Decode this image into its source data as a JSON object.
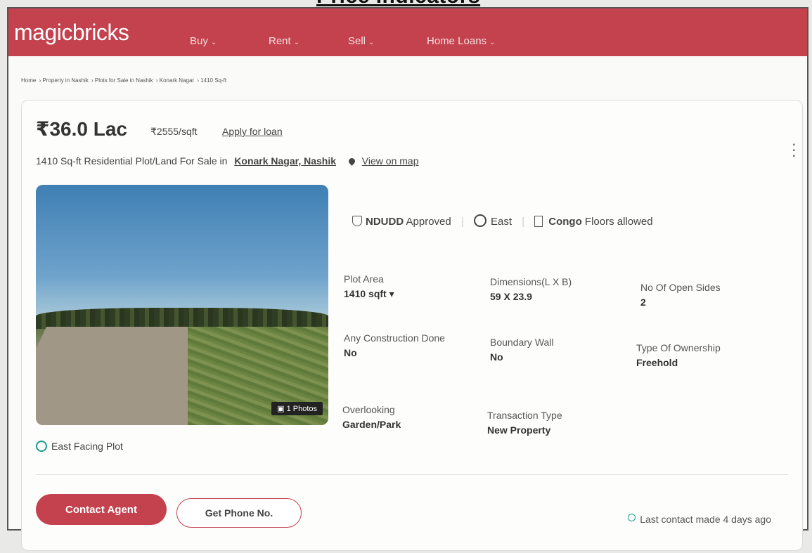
{
  "document": {
    "heading": "Price Indicators"
  },
  "header": {
    "logo": "magicbricks",
    "nav": [
      {
        "label": "Buy"
      },
      {
        "label": "Rent"
      },
      {
        "label": "Sell"
      },
      {
        "label": "Home Loans"
      }
    ]
  },
  "breadcrumb": [
    "Home",
    "Property in Nashik",
    "Plots for Sale in Nashik",
    "Konark Nagar",
    "1410 Sq-ft"
  ],
  "listing": {
    "price": "₹36.0 Lac",
    "rate": "₹2555/sqft",
    "apply_loan": "Apply for loan",
    "title_prefix": "1410 Sq-ft Residential Plot/Land For Sale in",
    "location": "Konark Nagar, Nashik",
    "map_link": "View on map",
    "photo_badge": "1 Photos",
    "highlights": {
      "approval_strong": "NDUDD",
      "approval_rest": "Approved",
      "facing": "East",
      "floors_strong": "Congo",
      "floors_rest": "Floors allowed"
    },
    "attributes": [
      {
        "label": "Plot Area",
        "value": "1410 sqft ▾"
      },
      {
        "label": "Dimensions(L X B)",
        "value": "59 X 23.9"
      },
      {
        "label": "No Of Open Sides",
        "value": "2"
      },
      {
        "label": "Any Construction Done",
        "value": "No"
      },
      {
        "label": "Boundary Wall",
        "value": "No"
      },
      {
        "label": "Type Of Ownership",
        "value": "Freehold"
      },
      {
        "label": "Overlooking",
        "value": "Garden/Park"
      },
      {
        "label": "Transaction Type",
        "value": "New Property"
      }
    ],
    "feature": "East Facing Plot"
  },
  "actions": {
    "contact_agent": "Contact Agent",
    "get_phone": "Get Phone No.",
    "last_contact": "Last contact made 4 days ago"
  },
  "colors": {
    "brand": "#c4414e",
    "accent": "#1a9a8a"
  }
}
